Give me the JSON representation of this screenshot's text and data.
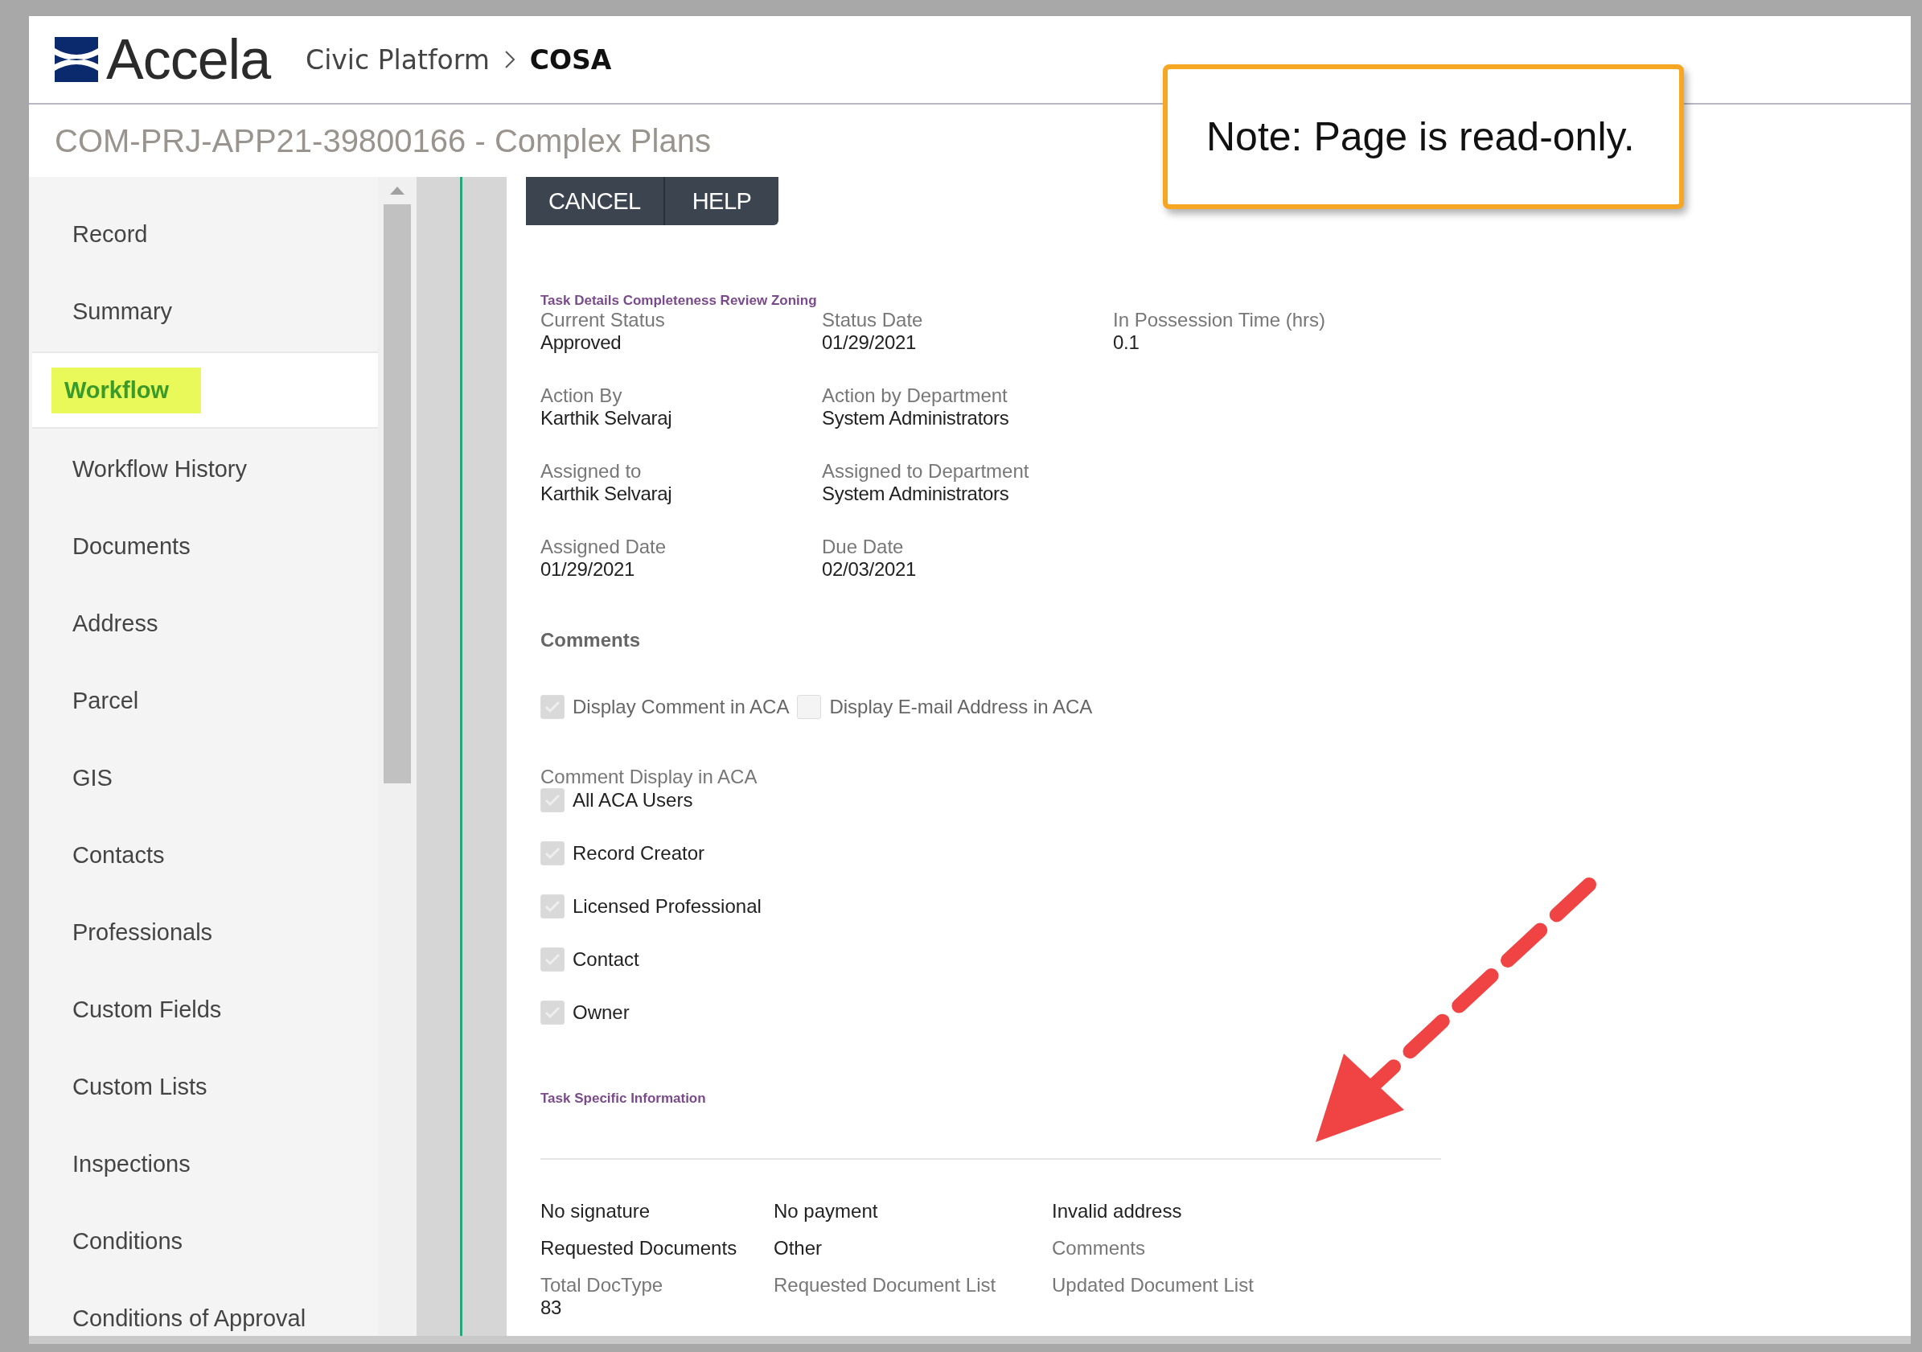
{
  "header": {
    "logo": "Accela",
    "breadcrumb": [
      "Civic Platform",
      "COSA"
    ]
  },
  "title": "COM-PRJ-APP21-39800166 - Complex Plans",
  "note": "Note: Page is read-only.",
  "sidebar": {
    "items": [
      {
        "label": "Record",
        "selected": false
      },
      {
        "label": "Summary",
        "selected": false
      },
      {
        "label": "Workflow",
        "selected": true
      },
      {
        "label": "Workflow History",
        "selected": false
      },
      {
        "label": "Documents",
        "selected": false
      },
      {
        "label": "Address",
        "selected": false
      },
      {
        "label": "Parcel",
        "selected": false
      },
      {
        "label": "GIS",
        "selected": false
      },
      {
        "label": "Contacts",
        "selected": false
      },
      {
        "label": "Professionals",
        "selected": false
      },
      {
        "label": "Custom Fields",
        "selected": false
      },
      {
        "label": "Custom Lists",
        "selected": false
      },
      {
        "label": "Inspections",
        "selected": false
      },
      {
        "label": "Conditions",
        "selected": false
      },
      {
        "label": "Conditions of Approval",
        "selected": false
      }
    ]
  },
  "buttons": [
    "CANCEL",
    "HELP"
  ],
  "task_details": {
    "heading": "Task Details Completeness Review Zoning",
    "rows": [
      [
        {
          "label": "Current Status",
          "value": "Approved"
        },
        {
          "label": "Status Date",
          "value": "01/29/2021"
        },
        {
          "label": "In Possession Time (hrs)",
          "value": "0.1"
        }
      ],
      [
        {
          "label": "Action By",
          "value": "Karthik Selvaraj"
        },
        {
          "label": "Action by Department",
          "value": "System Administrators"
        }
      ],
      [
        {
          "label": "Assigned to",
          "value": "Karthik Selvaraj"
        },
        {
          "label": "Assigned to Department",
          "value": "System Administrators"
        }
      ],
      [
        {
          "label": "Assigned Date",
          "value": "01/29/2021"
        },
        {
          "label": "Due Date",
          "value": "02/03/2021"
        }
      ]
    ]
  },
  "comments": {
    "heading": "Comments",
    "options": [
      {
        "label": "Display Comment in ACA",
        "checked": true
      },
      {
        "label": "Display E-mail Address in ACA",
        "checked": false
      }
    ],
    "display": {
      "label": "Comment Display in ACA",
      "options": [
        {
          "label": "All ACA Users",
          "checked": true
        },
        {
          "label": "Record Creator",
          "checked": true
        },
        {
          "label": "Licensed Professional",
          "checked": true
        },
        {
          "label": "Contact",
          "checked": true
        },
        {
          "label": "Owner",
          "checked": true
        }
      ]
    }
  },
  "task_specific": {
    "heading": "Task Specific Information",
    "rows": [
      [
        {
          "kind": "flag",
          "label": "No signature"
        },
        {
          "kind": "flag",
          "label": "No payment"
        },
        {
          "kind": "flag",
          "label": "Invalid address"
        }
      ],
      [
        {
          "kind": "flag",
          "label": "Requested Documents"
        },
        {
          "kind": "flag",
          "label": "Other"
        },
        {
          "kind": "field",
          "label": "Comments"
        }
      ],
      [
        {
          "kind": "field",
          "label": "Total DocType",
          "value": "83"
        },
        {
          "kind": "field",
          "label": "Requested Document List"
        },
        {
          "kind": "field",
          "label": "Updated Document List"
        }
      ]
    ]
  }
}
